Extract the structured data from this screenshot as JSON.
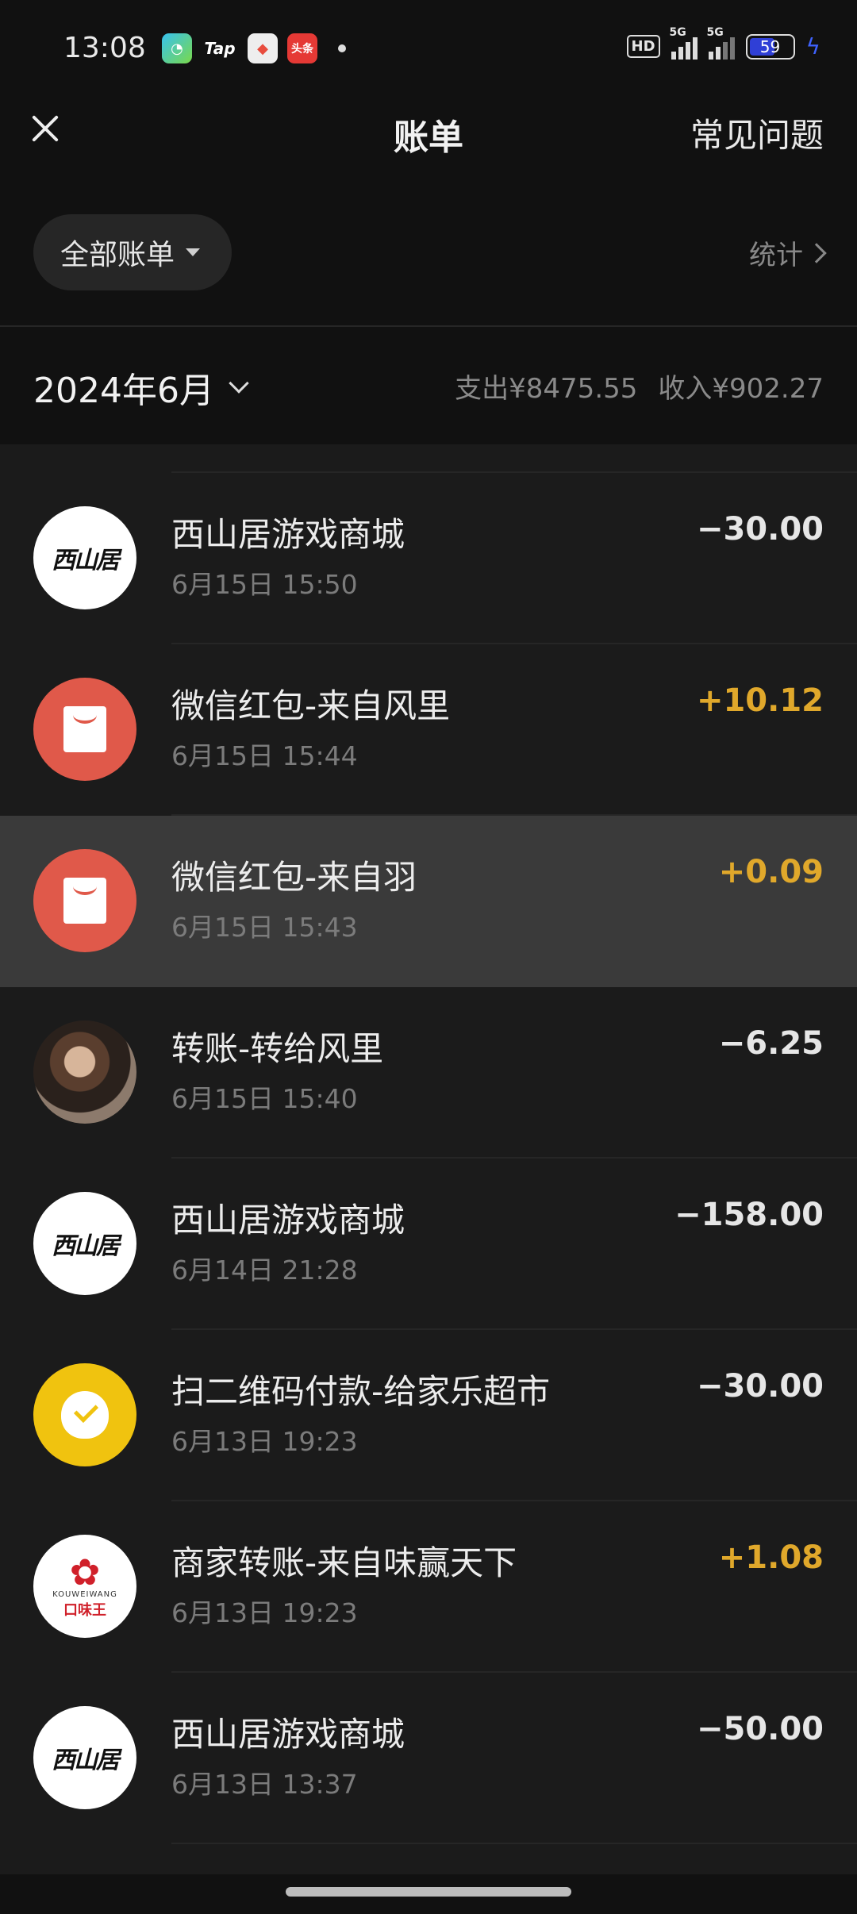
{
  "status_bar": {
    "time": "13:08",
    "notifications": [
      "app-icon",
      "Tap",
      "game-icon",
      "头条"
    ],
    "hd": "HD",
    "signal1": "5G",
    "signal2": "5G",
    "battery": "59"
  },
  "nav": {
    "title": "账单",
    "faq": "常见问题"
  },
  "filter": {
    "label": "全部账单",
    "stats": "统计"
  },
  "month": {
    "label": "2024年6月",
    "expense": "支出¥8475.55",
    "income": "收入¥902.27"
  },
  "transactions": [
    {
      "title": "西山居游戏商城",
      "time": "6月15日 15:50",
      "amount": "−30.00",
      "avatar": "xishanju-logo",
      "type": "expense"
    },
    {
      "title": "微信红包-来自风里",
      "time": "6月15日 15:44",
      "amount": "+10.12",
      "avatar": "red-packet-icon",
      "type": "income"
    },
    {
      "title": "微信红包-来自羽",
      "time": "6月15日 15:43",
      "amount": "+0.09",
      "avatar": "red-packet-icon",
      "type": "income"
    },
    {
      "title": "转账-转给风里",
      "time": "6月15日 15:40",
      "amount": "−6.25",
      "avatar": "user-photo",
      "type": "expense"
    },
    {
      "title": "西山居游戏商城",
      "time": "6月14日 21:28",
      "amount": "−158.00",
      "avatar": "xishanju-logo",
      "type": "expense"
    },
    {
      "title": "扫二维码付款-给家乐超市",
      "time": "6月13日 19:23",
      "amount": "−30.00",
      "avatar": "money-bag-icon",
      "type": "expense"
    },
    {
      "title": "商家转账-来自味赢天下",
      "time": "6月13日 19:23",
      "amount": "+1.08",
      "avatar": "kouweiwang-logo",
      "type": "income"
    },
    {
      "title": "西山居游戏商城",
      "time": "6月13日 13:37",
      "amount": "−50.00",
      "avatar": "xishanju-logo",
      "type": "expense"
    }
  ],
  "logos": {
    "xishanju": "西山居",
    "kouweiwang_en": "KOUWEIWANG",
    "kouweiwang_cn": "口味王"
  },
  "colors": {
    "background": "#1b1b1b",
    "income": "#e0a82b",
    "red_packet": "#e0594a",
    "qr_pay": "#f0c30f",
    "highlight_row": "#3a3a3a"
  }
}
